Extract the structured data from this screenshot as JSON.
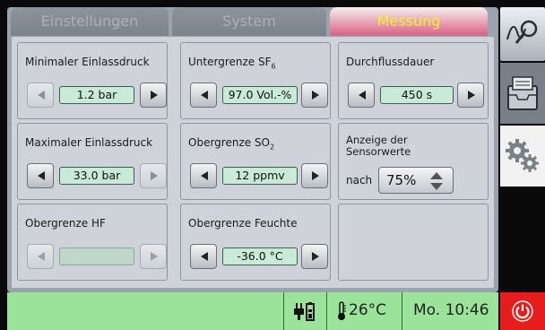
{
  "tabs": [
    "Einstellungen",
    "System",
    "Messung"
  ],
  "active_tab": "Messung",
  "settings": {
    "min_inlet_pressure": {
      "label": "Minimaler Einlassdruck",
      "value": "1.2 bar"
    },
    "max_inlet_pressure": {
      "label": "Maximaler Einlassdruck",
      "value": "33.0 bar"
    },
    "hf_limit": {
      "label": "Obergrenze HF",
      "value": ""
    },
    "sf6_lower_limit": {
      "label_main": "Untergrenze SF",
      "label_sub": "6",
      "value": "97.0 Vol.-%"
    },
    "so2_upper_limit": {
      "label_main": "Obergrenze SO",
      "label_sub": "2",
      "value": "12 ppmv"
    },
    "humidity_upper_limit": {
      "label": "Obergrenze Feuchte",
      "value": "-36.0 °C"
    },
    "flow_duration": {
      "label": "Durchflussdauer",
      "value": "450 s"
    },
    "sensor_display": {
      "label_line1": "Anzeige der",
      "label_line2": "Sensorwerte",
      "prefix": "nach",
      "value": "75%"
    }
  },
  "status": {
    "temperature": "26°C",
    "datetime": "Mo. 10:46"
  },
  "colors": {
    "active_tab_text": "#f6f020",
    "status_bar": "#9be39a",
    "value_field": "#c9ead7",
    "stop_button": "#e71d1d"
  }
}
